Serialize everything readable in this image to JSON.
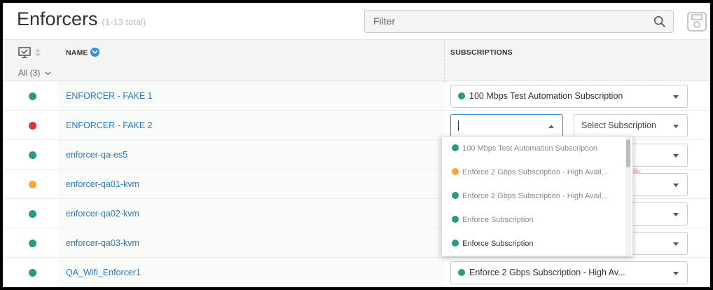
{
  "header": {
    "title": "Enforcers",
    "count": "(1-13 total)",
    "filter_placeholder": "Filter"
  },
  "columns": {
    "status_filter": "All (3)",
    "name": "NAME",
    "subscriptions": "SUBSCRIPTIONS"
  },
  "status_colors": {
    "green": "#279a84",
    "red": "#e13434",
    "orange": "#f6a93b"
  },
  "rows": [
    {
      "status": "green",
      "name": "ENFORCER - FAKE 1",
      "subscription": "100 Mbps Test Automation Subscription",
      "subscription_status": "green"
    },
    {
      "status": "red",
      "name": "ENFORCER - FAKE 2",
      "subscription": "",
      "select_placeholder": "Select Subscription"
    },
    {
      "status": "green",
      "name": "enforcer-qa-es5"
    },
    {
      "status": "orange",
      "name": "enforcer-qa01-kvm"
    },
    {
      "status": "green",
      "name": "enforcer-qa02-kvm"
    },
    {
      "status": "green",
      "name": "enforcer-qa03-kvm"
    },
    {
      "status": "green",
      "name": "QA_Wifi_Enforcer1",
      "subscription": "Enforce 2 Gbps Subscription - High Av...",
      "subscription_status": "green"
    }
  ],
  "dropdown": {
    "options": [
      {
        "label": "100 Mbps Test Automation Subscription",
        "status": "green"
      },
      {
        "label": "Enforce 2 Gbps Subscription - High Avail...",
        "status": "orange"
      },
      {
        "label": "Enforce 2 Gbps Subscription - High Avail...",
        "status": "green"
      },
      {
        "label": "Enforce Subscription",
        "status": "green"
      },
      {
        "label": "Enforce Subscription",
        "status": "green"
      }
    ]
  }
}
